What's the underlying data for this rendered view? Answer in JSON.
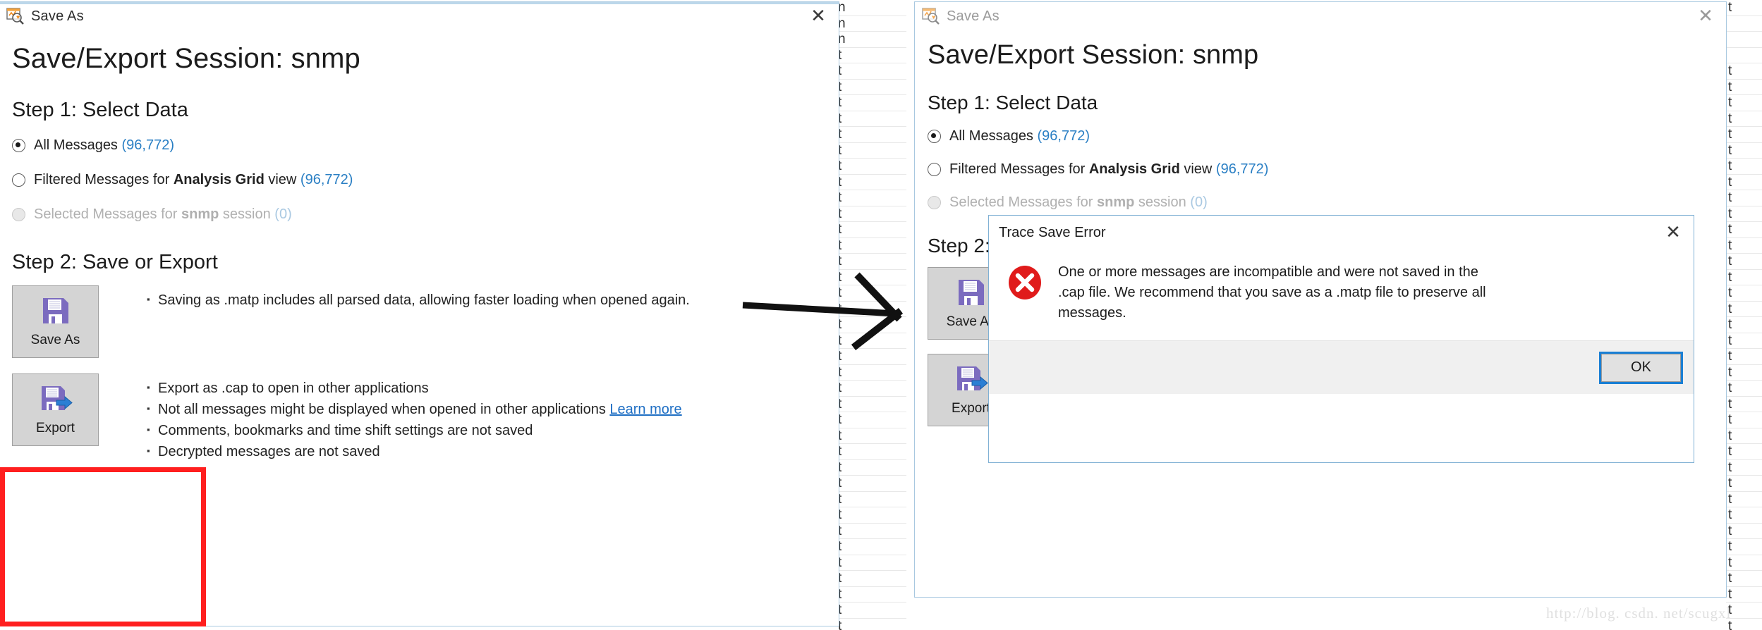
{
  "window": {
    "title": "Save As",
    "heading": "Save/Export Session:  snmp",
    "close_label": "✕"
  },
  "step1": {
    "heading": "Step 1: Select Data",
    "options": [
      {
        "label": "All Messages",
        "bold": "",
        "suffix": "",
        "count": "(96,772)",
        "checked": true,
        "disabled": false
      },
      {
        "label": "Filtered Messages for ",
        "bold": "Analysis Grid",
        "suffix": " view ",
        "count": "(96,772)",
        "checked": false,
        "disabled": false
      },
      {
        "label": "Selected Messages for ",
        "bold": "snmp",
        "suffix": " session ",
        "count": "(0)",
        "checked": false,
        "disabled": true
      }
    ]
  },
  "step2": {
    "heading": "Step 2: Save or Export",
    "save": {
      "button_label": "Save As",
      "icon": "floppy-disk-icon",
      "bullets": [
        {
          "text": "Saving as .matp includes all parsed data, allowing faster loading when opened again.",
          "link": ""
        }
      ]
    },
    "export": {
      "button_label": "Export",
      "icon": "floppy-disk-export-icon",
      "bullets": [
        {
          "text": "Export as .cap to open in other applications",
          "link": ""
        },
        {
          "text": "Not all messages might be displayed when opened in other applications ",
          "link": "Learn more"
        },
        {
          "text": "Comments, bookmarks and time shift settings are not saved",
          "link": ""
        },
        {
          "text": "Decrypted messages are not saved",
          "link": ""
        }
      ]
    }
  },
  "error_dialog": {
    "title": "Trace Save Error",
    "close_label": "✕",
    "message": "One or more messages are incompatible and were not saved in the .cap file. We recommend that you save as a .matp file to preserve all messages.",
    "ok_label": "OK",
    "icon": "error-x-icon"
  },
  "annotation": {
    "highlight_color": "#ff1f1f",
    "arrow_name": "flow-arrow"
  },
  "watermark": {
    "text": "http://blog. csdn. net/scugxl"
  },
  "background": {
    "left_rows": [
      "n",
      "n",
      "n",
      "t",
      "t",
      "t",
      "t",
      "t",
      "t",
      "t",
      "t",
      "t",
      "t",
      "t",
      "t",
      "t",
      "t",
      "t",
      "t",
      "t",
      "t",
      "t",
      "t",
      "t",
      "t",
      "t",
      "t",
      "t",
      "t",
      "t",
      "t",
      "t",
      "t",
      "t",
      "t",
      "t",
      "t",
      "t",
      "t",
      "t"
    ],
    "right_rows": [
      "t",
      "",
      "",
      "",
      "t",
      "t",
      "t",
      "t",
      "t",
      "t",
      "t",
      "t",
      "t",
      "t",
      "t",
      "t",
      "t",
      "t",
      "t",
      "t",
      "t",
      "t",
      "t",
      "t",
      "t",
      "t",
      "t",
      "t",
      "t",
      "t",
      "t",
      "t",
      "t",
      "t",
      "t",
      "t",
      "t",
      "t",
      "t",
      "t"
    ]
  },
  "colors": {
    "accent_blue": "#2a7fc4",
    "link_blue": "#1f6fc4",
    "error_red": "#e01b1b",
    "floppy_purple": "#7b6bbf",
    "export_arrow_blue": "#2b7fd4",
    "focus_blue": "#1a7fd4"
  }
}
